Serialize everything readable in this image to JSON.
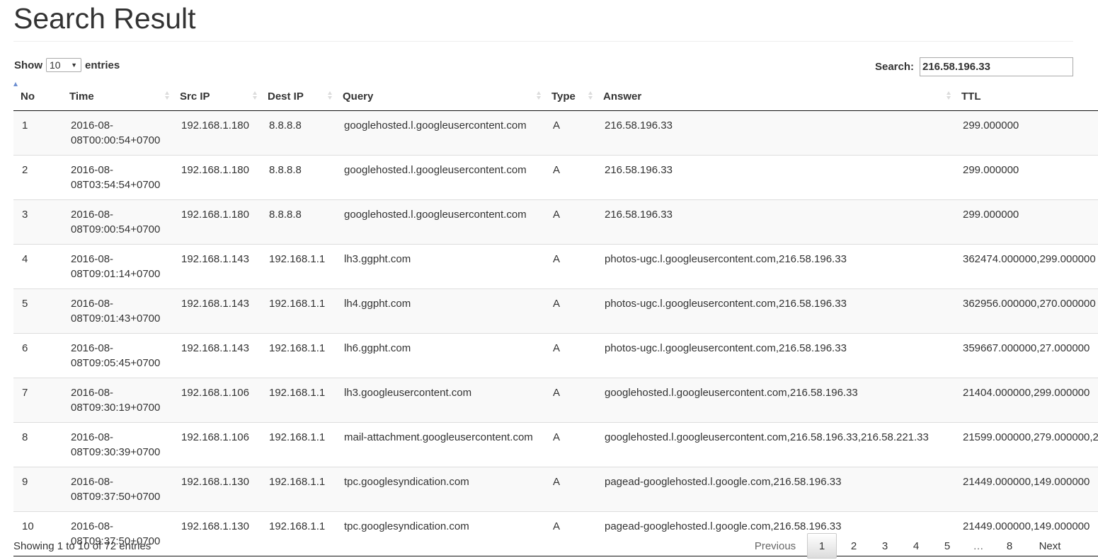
{
  "page": {
    "title": "Search Result"
  },
  "controls": {
    "show_label": "Show",
    "entries_label": "entries",
    "length_value": "10",
    "search_label": "Search:",
    "search_value": "216.58.196.33"
  },
  "table": {
    "columns": [
      "No",
      "Time",
      "Src IP",
      "Dest IP",
      "Query",
      "Type",
      "Answer",
      "TTL"
    ],
    "rows": [
      {
        "no": "1",
        "time": "2016-08-08T00:00:54+0700",
        "src": "192.168.1.180",
        "dest": "8.8.8.8",
        "query": "googlehosted.l.googleusercontent.com",
        "type": "A",
        "answer": "216.58.196.33",
        "ttl": "299.000000"
      },
      {
        "no": "2",
        "time": "2016-08-08T03:54:54+0700",
        "src": "192.168.1.180",
        "dest": "8.8.8.8",
        "query": "googlehosted.l.googleusercontent.com",
        "type": "A",
        "answer": "216.58.196.33",
        "ttl": "299.000000"
      },
      {
        "no": "3",
        "time": "2016-08-08T09:00:54+0700",
        "src": "192.168.1.180",
        "dest": "8.8.8.8",
        "query": "googlehosted.l.googleusercontent.com",
        "type": "A",
        "answer": "216.58.196.33",
        "ttl": "299.000000"
      },
      {
        "no": "4",
        "time": "2016-08-08T09:01:14+0700",
        "src": "192.168.1.143",
        "dest": "192.168.1.1",
        "query": "lh3.ggpht.com",
        "type": "A",
        "answer": "photos-ugc.l.googleusercontent.com,216.58.196.33",
        "ttl": "362474.000000,299.000000"
      },
      {
        "no": "5",
        "time": "2016-08-08T09:01:43+0700",
        "src": "192.168.1.143",
        "dest": "192.168.1.1",
        "query": "lh4.ggpht.com",
        "type": "A",
        "answer": "photos-ugc.l.googleusercontent.com,216.58.196.33",
        "ttl": "362956.000000,270.000000"
      },
      {
        "no": "6",
        "time": "2016-08-08T09:05:45+0700",
        "src": "192.168.1.143",
        "dest": "192.168.1.1",
        "query": "lh6.ggpht.com",
        "type": "A",
        "answer": "photos-ugc.l.googleusercontent.com,216.58.196.33",
        "ttl": "359667.000000,27.000000"
      },
      {
        "no": "7",
        "time": "2016-08-08T09:30:19+0700",
        "src": "192.168.1.106",
        "dest": "192.168.1.1",
        "query": "lh3.googleusercontent.com",
        "type": "A",
        "answer": "googlehosted.l.googleusercontent.com,216.58.196.33",
        "ttl": "21404.000000,299.000000"
      },
      {
        "no": "8",
        "time": "2016-08-08T09:30:39+0700",
        "src": "192.168.1.106",
        "dest": "192.168.1.1",
        "query": "mail-attachment.googleusercontent.com",
        "type": "A",
        "answer": "googlehosted.l.googleusercontent.com,216.58.196.33,216.58.221.33",
        "ttl": "21599.000000,279.000000,2"
      },
      {
        "no": "9",
        "time": "2016-08-08T09:37:50+0700",
        "src": "192.168.1.130",
        "dest": "192.168.1.1",
        "query": "tpc.googlesyndication.com",
        "type": "A",
        "answer": "pagead-googlehosted.l.google.com,216.58.196.33",
        "ttl": "21449.000000,149.000000"
      },
      {
        "no": "10",
        "time": "2016-08-08T09:37:50+0700",
        "src": "192.168.1.130",
        "dest": "192.168.1.1",
        "query": "tpc.googlesyndication.com",
        "type": "A",
        "answer": "pagead-googlehosted.l.google.com,216.58.196.33",
        "ttl": "21449.000000,149.000000"
      }
    ]
  },
  "footer": {
    "info": "Showing 1 to 10 of 72 entries",
    "previous": "Previous",
    "next": "Next",
    "pages": [
      "1",
      "2",
      "3",
      "4",
      "5"
    ],
    "ellipsis": "…",
    "last_page": "8"
  }
}
